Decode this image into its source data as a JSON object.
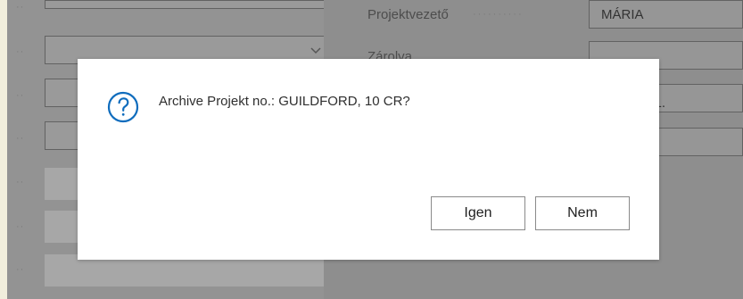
{
  "background": {
    "right_top_label": "Projektvezető",
    "right_top_value": "MÁRIA",
    "partial_label": "Zárolva",
    "partial_value": ". 11."
  },
  "dialog": {
    "message": "Archive Projekt no.: GUILDFORD, 10 CR?",
    "buttons": {
      "yes": "Igen",
      "no": "Nem"
    },
    "icon": "question-icon"
  },
  "colors": {
    "overlay": "#8e8e8e",
    "dialog_bg": "#ffffff",
    "accent": "#0f6cbd",
    "border": "#8a8a8a"
  }
}
